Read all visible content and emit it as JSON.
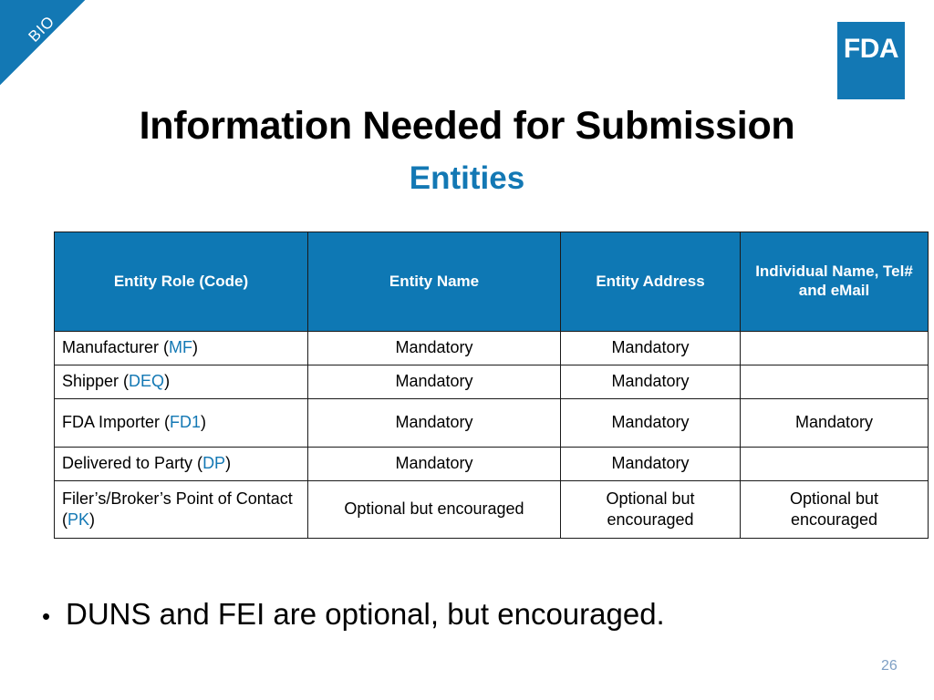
{
  "ribbon": {
    "label": "BIO"
  },
  "logo": {
    "text": "FDA"
  },
  "title": {
    "main": "Information Needed for Submission",
    "sub": "Entities"
  },
  "table": {
    "headers": [
      "Entity Role (Code)",
      "Entity Name",
      "Entity Address",
      "Individual Name, Tel# and eMail"
    ],
    "rows": [
      {
        "role_name": "Manufacturer (",
        "role_code": "MF",
        "role_close": ")",
        "entity_name": "Mandatory",
        "entity_address": "Mandatory",
        "individual": ""
      },
      {
        "role_name": "Shipper (",
        "role_code": "DEQ",
        "role_close": ")",
        "entity_name": "Mandatory",
        "entity_address": "Mandatory",
        "individual": ""
      },
      {
        "role_name": "FDA Importer (",
        "role_code": "FD1",
        "role_close": ")",
        "entity_name": "Mandatory",
        "entity_address": "Mandatory",
        "individual": "Mandatory"
      },
      {
        "role_name": "Delivered to Party (",
        "role_code": "DP",
        "role_close": ")",
        "entity_name": "Mandatory",
        "entity_address": "Mandatory",
        "individual": ""
      },
      {
        "role_name": "Filer’s/Broker’s Point of Contact (",
        "role_code": "PK",
        "role_close": ")",
        "entity_name": "Optional but encouraged",
        "entity_address": "Optional but encouraged",
        "individual": "Optional but encouraged"
      }
    ]
  },
  "bullet": {
    "marker": "•",
    "text": "DUNS and FEI are optional, but encouraged."
  },
  "footer": {
    "page_number": "26"
  },
  "colors": {
    "brand_blue": "#1378B4",
    "header_blue": "#0E78B4",
    "page_number": "#7E9FC4"
  }
}
